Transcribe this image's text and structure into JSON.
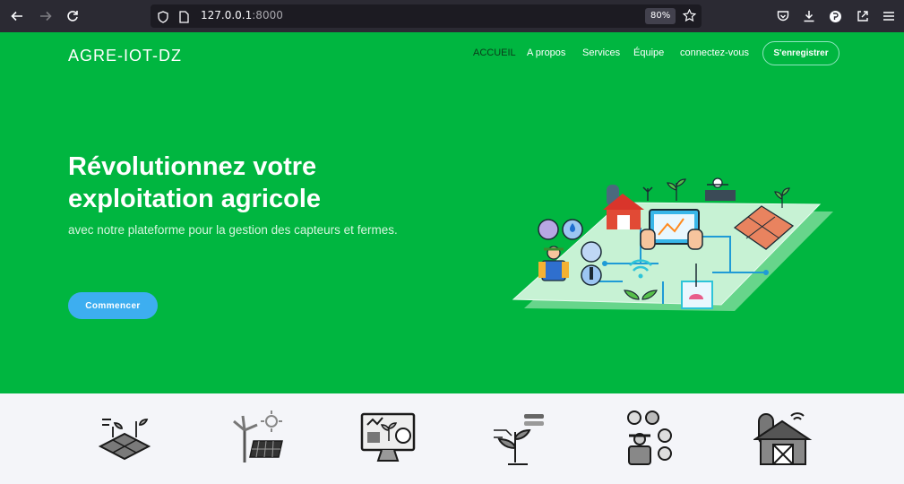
{
  "browser": {
    "url_host": "127.0.0.1",
    "url_port": ":8000",
    "zoom": "80%",
    "icons": [
      "back-arrow-icon",
      "forward-arrow-icon",
      "reload-icon",
      "shield-icon",
      "page-icon",
      "star-icon",
      "pocket-icon",
      "download-icon",
      "extension-icon",
      "share-icon",
      "menu-icon"
    ]
  },
  "header": {
    "brand": "AGRE-IOT-DZ",
    "nav": [
      {
        "label": "ACCUEIL",
        "active": true
      },
      {
        "label": "A propos",
        "active": false
      },
      {
        "label": "Services",
        "active": false
      },
      {
        "label": "Équipe",
        "active": false
      },
      {
        "label": "connectez-vous",
        "active": false
      }
    ],
    "register_label": "S'enregistrer"
  },
  "hero": {
    "title": "Révolutionnez votre exploitation agricole",
    "subtitle": "avec notre plateforme pour la gestion des capteurs et fermes.",
    "cta_label": "Commencer",
    "illustration": "smart-farm-illustration"
  },
  "features": {
    "icons": [
      "smart-field-icon",
      "renewable-energy-icon",
      "monitoring-dashboard-icon",
      "plant-sensor-icon",
      "farmer-sensors-icon",
      "connected-barn-icon"
    ]
  },
  "colors": {
    "hero_bg": "#00b640",
    "cta_bg": "#3daef0",
    "nav_active": "#0b3a1a",
    "features_bg": "#f4f5f9"
  }
}
